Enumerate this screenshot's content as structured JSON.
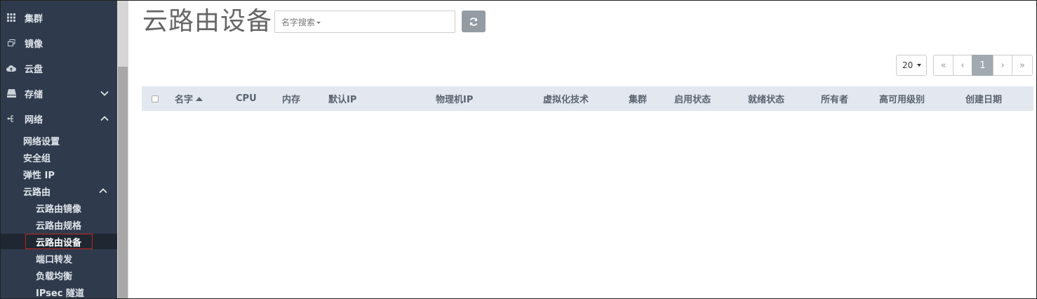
{
  "sidebar": {
    "items": [
      {
        "label": "集群",
        "icon": "grid-icon"
      },
      {
        "label": "镜像",
        "icon": "image-icon"
      },
      {
        "label": "云盘",
        "icon": "cloud-disk-icon"
      },
      {
        "label": "存储",
        "icon": "storage-icon"
      },
      {
        "label": "网络",
        "icon": "network-icon"
      }
    ],
    "network_sub": [
      "网络设置",
      "安全组",
      "弹性 IP",
      "云路由"
    ],
    "router_sub": [
      "云路由镜像",
      "云路由规格",
      "云路由设备",
      "端口转发",
      "负载均衡",
      "IPsec 隧道"
    ]
  },
  "page": {
    "title": "云路由设备",
    "search_label": "名字搜索",
    "page_size": "20",
    "pagination": [
      "«",
      "‹",
      "1",
      "›",
      "»"
    ]
  },
  "table": {
    "columns": [
      "名字",
      "CPU",
      "内存",
      "默认IP",
      "物理机IP",
      "虚拟化技术",
      "集群",
      "启用状态",
      "就绪状态",
      "所有者",
      "高可用级别",
      "创建日期"
    ]
  },
  "colors": {
    "sidebar_bg": "#2f3b4c",
    "active_bg": "#1e2732",
    "highlight_border": "#c0271e",
    "table_header_bg": "#e3e8f0"
  }
}
